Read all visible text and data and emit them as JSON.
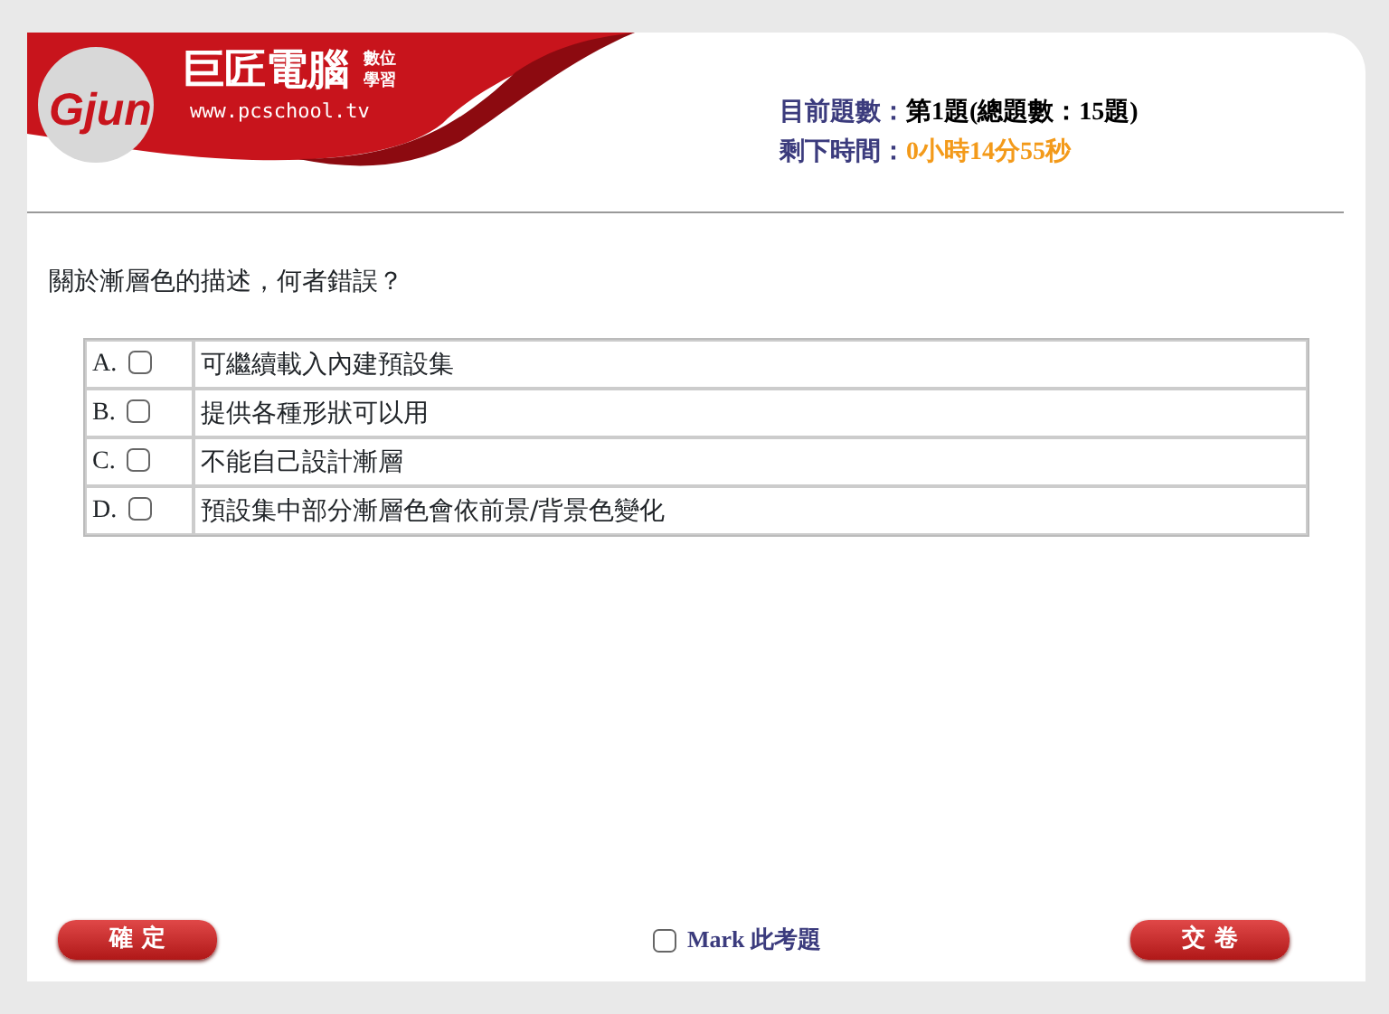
{
  "logo": {
    "brand": "Gjun",
    "name": "巨匠電腦",
    "tag_top": "數位",
    "tag_bottom": "學習",
    "url": "www.pcschool.tv"
  },
  "progress": {
    "label": "目前題數：",
    "value": "第1題(總題數：15題)"
  },
  "timer": {
    "label": "剩下時間：",
    "value": "0小時14分55秒"
  },
  "question": "關於漸層色的描述，何者錯誤？",
  "options": [
    {
      "letter": "A.",
      "text": "可繼續載入內建預設集",
      "checked": false
    },
    {
      "letter": "B.",
      "text": "提供各種形狀可以用",
      "checked": false
    },
    {
      "letter": "C.",
      "text": "不能自己設計漸層",
      "checked": false
    },
    {
      "letter": "D.",
      "text": "預設集中部分漸層色會依前景/背景色變化",
      "checked": false
    }
  ],
  "confirm_button": "確 定",
  "mark": {
    "label": "Mark 此考題",
    "checked": false
  },
  "submit_button": "交 卷"
}
